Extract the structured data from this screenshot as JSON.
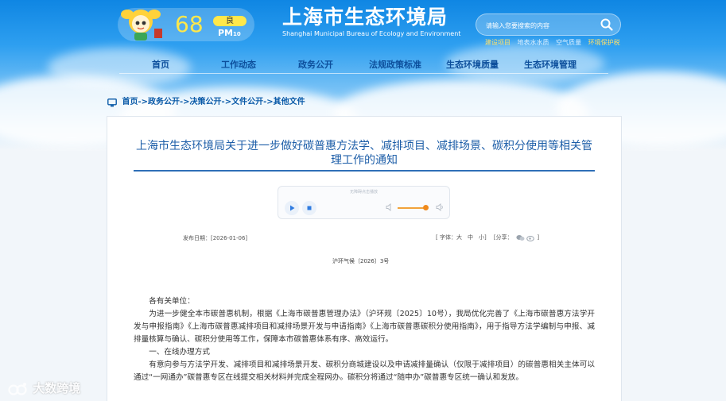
{
  "aqi": {
    "value": "68",
    "level": "良",
    "pollutant": "PM",
    "pollutant_sub": "10"
  },
  "logo": {
    "cn": "上海市生态环境局",
    "en": "Shanghai Municipal Bureau of Ecology and Environment"
  },
  "search": {
    "placeholder": "请输入您要搜索的内容"
  },
  "quick_links": [
    {
      "label": "建设项目",
      "color": "#ffe06a"
    },
    {
      "label": "地表水水质",
      "color": "#dff1ff"
    },
    {
      "label": "空气质量",
      "color": "#dff1ff"
    },
    {
      "label": "环境保护税",
      "color": "#ffe06a"
    }
  ],
  "nav": [
    "首页",
    "工作动态",
    "政务公开",
    "法规政策标准",
    "生态环境质量",
    "生态环境管理"
  ],
  "breadcrumb": [
    "首页",
    "->政务公开",
    "->决策公开",
    "->文件公开",
    "->其他文件"
  ],
  "article": {
    "title": "上海市生态环境局关于进一步做好碳普惠方法学、减排项目、减排场景、碳积分使用等相关管理工作的通知",
    "player_caption": "无障碍点击播放",
    "publish_label": "发布日期：",
    "publish_date": "[2026-01-06]",
    "font_label": "[ 字体：大　中　小]",
    "share_label": "[分享：",
    "share_end": "]",
    "doc_no": "沪环气候〔2026〕3号",
    "greeting": "各有关单位：",
    "para1": "为进一步健全本市碳普惠机制，根据《上海市碳普惠管理办法》（沪环规〔2025〕10号），我局优化完善了《上海市碳普惠方法学开发与申报指南》《上海市碳普惠减排项目和减排场景开发与申请指南》《上海市碳普惠碳积分使用指南》，用于指导方法学编制与申报、减排量核算与确认、碳积分使用等工作，保障本市碳普惠体系有序、高效运行。",
    "section1": "一、在线办理方式",
    "para2": "有意向参与方法学开发、减排项目和减排场景开发、碳积分商城建设以及申请减排量确认（仅限于减排项目）的碳普惠相关主体可以通过“一网通办”碳普惠专区在线提交相关材料并完成全程网办。碳积分将通过“随申办”碳普惠专区统一确认和发放。"
  },
  "watermark": "大数跨境",
  "colors": {
    "nav": "#0d4f9c",
    "title": "#1d5ea8",
    "aqi": "#ffe84a",
    "sky": "#2e9ff0"
  }
}
